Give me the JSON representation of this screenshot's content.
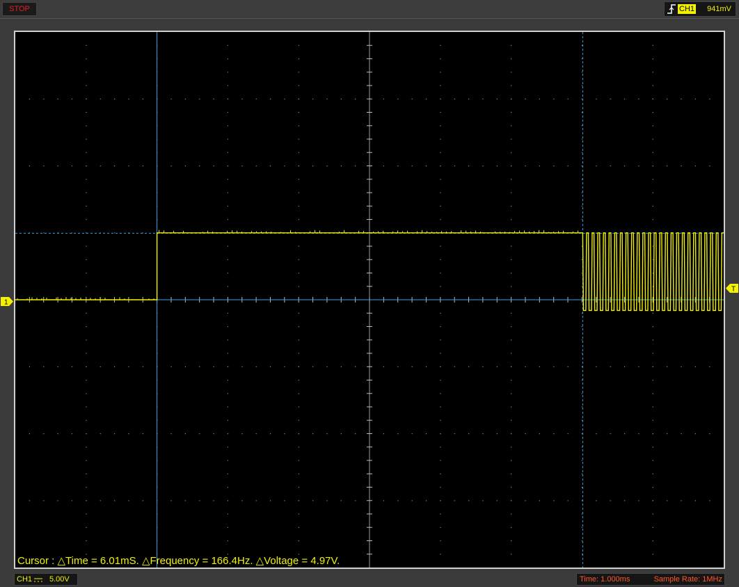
{
  "toolbar": {
    "run_state": "STOP",
    "trigger": {
      "edge_icon": "rising-edge-icon",
      "channel": "CH1",
      "level": "941mV"
    }
  },
  "display": {
    "cursor_readout": "Cursor : △Time = 6.01mS. △Frequency = 166.4Hz. △Voltage = 4.97V.",
    "channel_marker": "1",
    "trigger_marker": "T",
    "colors": {
      "trace": "#f2f200",
      "cursor": "#3aa0e8",
      "grid": "#8a8a8a",
      "background": "#000000"
    }
  },
  "status": {
    "channel": {
      "name": "CH1",
      "coupling_icon": "dc-coupling-icon",
      "volts_div": "5.00V"
    },
    "time_div": "Time: 1.000ms",
    "sample_rate": "Sample Rate: 1MHz"
  },
  "chart_data": {
    "type": "line",
    "divisions": {
      "x": 10,
      "y": 8
    },
    "volts_per_div": 5.0,
    "ms_per_div": 1.0,
    "grid": true,
    "cursors": {
      "time_div": [
        2.0,
        8.01
      ],
      "voltage_div": [
        0.0,
        0.994
      ]
    },
    "series": [
      {
        "segments": [
          {
            "from_div": 0.0,
            "to_div": 2.0,
            "level_div": 0.0,
            "type": "low"
          },
          {
            "from_div": 2.0,
            "to_div": 8.01,
            "level_div": 1.0,
            "type": "high"
          },
          {
            "from_div": 8.01,
            "to_div": 10.0,
            "type": "pulse-train",
            "high_div": 1.0,
            "low_div": -0.16,
            "pulses": 25
          }
        ]
      }
    ]
  }
}
